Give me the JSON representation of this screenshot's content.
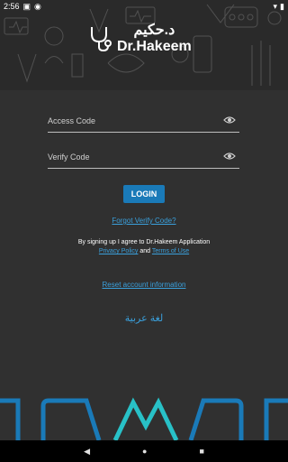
{
  "status": {
    "time": "2:56"
  },
  "brand": {
    "arabic": "د.حكيم",
    "english": "Dr.Hakeem"
  },
  "form": {
    "access_code_placeholder": "Access Code",
    "verify_code_placeholder": "Verify Code",
    "login_label": "LOGIN"
  },
  "links": {
    "forgot_verify": "Forgot Verify Code?",
    "agreement": "By signing up I agree to Dr.Hakeem Application",
    "privacy": "Privacy Policy",
    "and": "and",
    "terms": "Terms of Use",
    "reset": "Reset account information",
    "arabic_language": "لغة عربية"
  },
  "colors": {
    "accent": "#1a7ab8",
    "link": "#3aa0dc",
    "teal": "#28c1c7",
    "background": "#303030"
  },
  "icons": [
    "eye-icon",
    "stethoscope-logo-icon",
    "back-icon",
    "home-icon",
    "recents-icon"
  ]
}
